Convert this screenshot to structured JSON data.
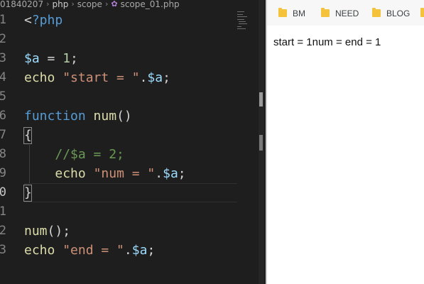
{
  "breadcrumb": {
    "project": "01840207",
    "folder1": "php",
    "folder2": "scope",
    "file": "scope_01.php"
  },
  "lines": [
    {
      "n": "1",
      "t": [
        [
          "punc",
          "<"
        ],
        [
          "kw",
          "?php"
        ]
      ]
    },
    {
      "n": "2",
      "t": []
    },
    {
      "n": "3",
      "t": [
        [
          "var",
          "$a"
        ],
        [
          "punc",
          " = "
        ],
        [
          "num",
          "1"
        ],
        [
          "punc",
          ";"
        ]
      ]
    },
    {
      "n": "4",
      "t": [
        [
          "fn",
          "echo"
        ],
        [
          "punc",
          " "
        ],
        [
          "str",
          "\"start = \""
        ],
        [
          "punc",
          "."
        ],
        [
          "var",
          "$a"
        ],
        [
          "punc",
          ";"
        ]
      ]
    },
    {
      "n": "5",
      "t": []
    },
    {
      "n": "6",
      "t": [
        [
          "kw",
          "function"
        ],
        [
          "punc",
          " "
        ],
        [
          "fn",
          "num"
        ],
        [
          "punc",
          "()"
        ]
      ]
    },
    {
      "n": "7",
      "t": [
        [
          "punc",
          "{"
        ]
      ]
    },
    {
      "n": "8",
      "t": [
        [
          "punc",
          "    "
        ],
        [
          "cmt",
          "//$a = 2;"
        ]
      ]
    },
    {
      "n": "9",
      "t": [
        [
          "punc",
          "    "
        ],
        [
          "fn",
          "echo"
        ],
        [
          "punc",
          " "
        ],
        [
          "str",
          "\"num = \""
        ],
        [
          "punc",
          "."
        ],
        [
          "var",
          "$a"
        ],
        [
          "punc",
          ";"
        ]
      ]
    },
    {
      "n": "0",
      "t": [
        [
          "punc",
          "}"
        ]
      ],
      "active": true
    },
    {
      "n": "1",
      "t": []
    },
    {
      "n": "2",
      "t": [
        [
          "fn",
          "num"
        ],
        [
          "punc",
          "();"
        ]
      ]
    },
    {
      "n": "3",
      "t": [
        [
          "fn",
          "echo"
        ],
        [
          "punc",
          " "
        ],
        [
          "str",
          "\"end = \""
        ],
        [
          "punc",
          "."
        ],
        [
          "var",
          "$a"
        ],
        [
          "punc",
          ";"
        ]
      ]
    }
  ],
  "browser": {
    "bookmarks": [
      "BM",
      "NEED",
      "BLOG"
    ],
    "output": "start = 1num = end = 1"
  },
  "colors": {
    "editor_bg": "#1e1e1e",
    "keyword": "#569cd6",
    "variable": "#9cdcfe",
    "function": "#dcdcaa",
    "string": "#ce9178",
    "number": "#b5cea8",
    "comment": "#6a9955",
    "folder": "#f4c33b"
  }
}
